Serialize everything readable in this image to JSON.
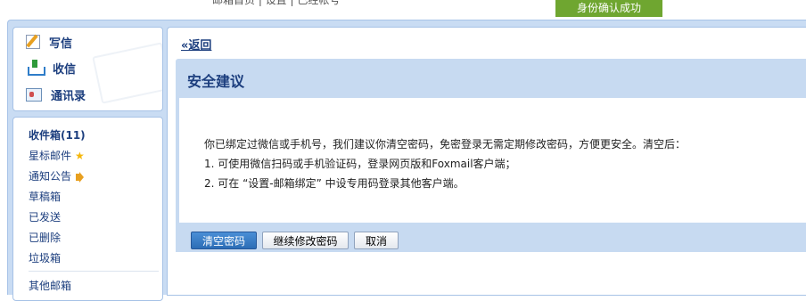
{
  "header": {
    "top_links": "邮箱首页 | 设置 | 已经帐号",
    "verify_badge": "身份确认成功"
  },
  "quick_actions": [
    {
      "label": "写信",
      "icon": "compose-icon"
    },
    {
      "label": "收信",
      "icon": "inbox-download-icon"
    },
    {
      "label": "通讯录",
      "icon": "contacts-card-icon"
    }
  ],
  "folders": [
    {
      "label": "收件箱(11)",
      "bold": true
    },
    {
      "label": "星标邮件",
      "icon": "star-icon",
      "icon_glyph": "★"
    },
    {
      "label": "通知公告",
      "icon": "speaker-icon"
    },
    {
      "label": "草稿箱"
    },
    {
      "label": "已发送"
    },
    {
      "label": "已删除"
    },
    {
      "label": "垃圾箱"
    },
    {
      "label": "其他邮箱"
    }
  ],
  "main": {
    "back_link": "«返回",
    "title": "安全建议",
    "lines": [
      "你已绑定过微信或手机号，我们建议你清空密码，免密登录无需定期修改密码，方便更安全。清空后：",
      "1. 可使用微信扫码或手机验证码，登录网页版和Foxmail客户端；",
      "2. 可在 “设置-邮箱绑定” 中设专用码登录其他客户端。"
    ],
    "buttons": {
      "clear_password": "清空密码",
      "continue_modify": "继续修改密码",
      "cancel": "取消"
    }
  },
  "colors": {
    "accent_blue": "#1c3e7e",
    "panel_blue": "#c7daf1",
    "badge_green": "#6fa630",
    "primary_button": "#2c6db6"
  }
}
